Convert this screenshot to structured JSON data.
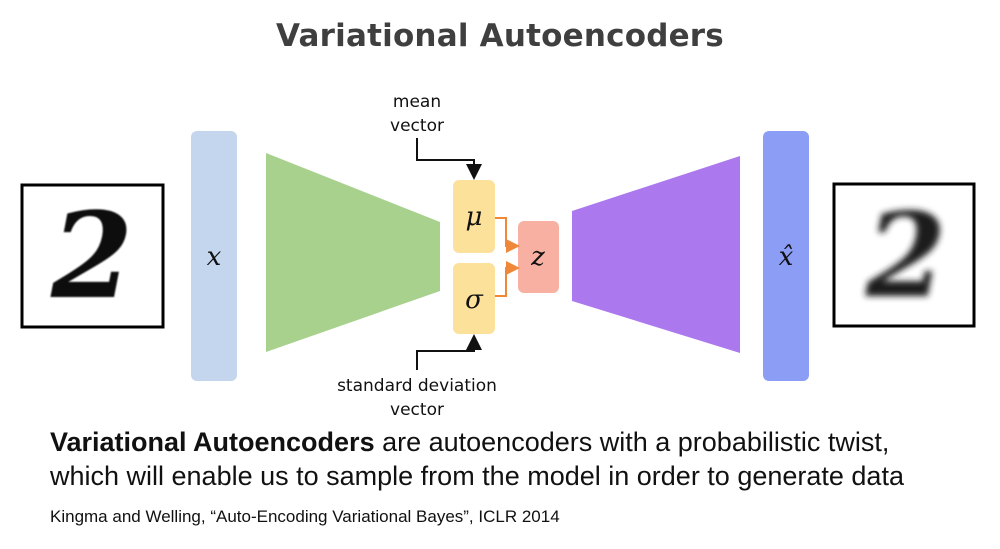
{
  "title": "Variational Autoencoders",
  "diagram": {
    "input_symbol": "x",
    "output_symbol": "x̂",
    "mean_symbol": "μ",
    "std_symbol": "σ",
    "latent_symbol": "z",
    "mean_label_line1": "mean",
    "mean_label_line2": "vector",
    "std_label_line1": "standard deviation",
    "std_label_line2": "vector",
    "input_digit": "2",
    "output_digit": "2",
    "colors": {
      "input_bar": "#c3d6ee",
      "encoder": "#a8d18d",
      "mu_sigma_box": "#fce19a",
      "z_box": "#f8b0a2",
      "decoder": "#ab79ed",
      "output_bar": "#8c9df5",
      "arrow_orange": "#f0883a"
    }
  },
  "caption": {
    "bold": "Variational Autoencoders",
    "line1_rest": " are autoencoders with a probabilistic twist,",
    "line2": "which will enable us to sample from the model in order to generate data"
  },
  "citation": "Kingma and Welling, “Auto-Encoding Variational Bayes”, ICLR 2014"
}
